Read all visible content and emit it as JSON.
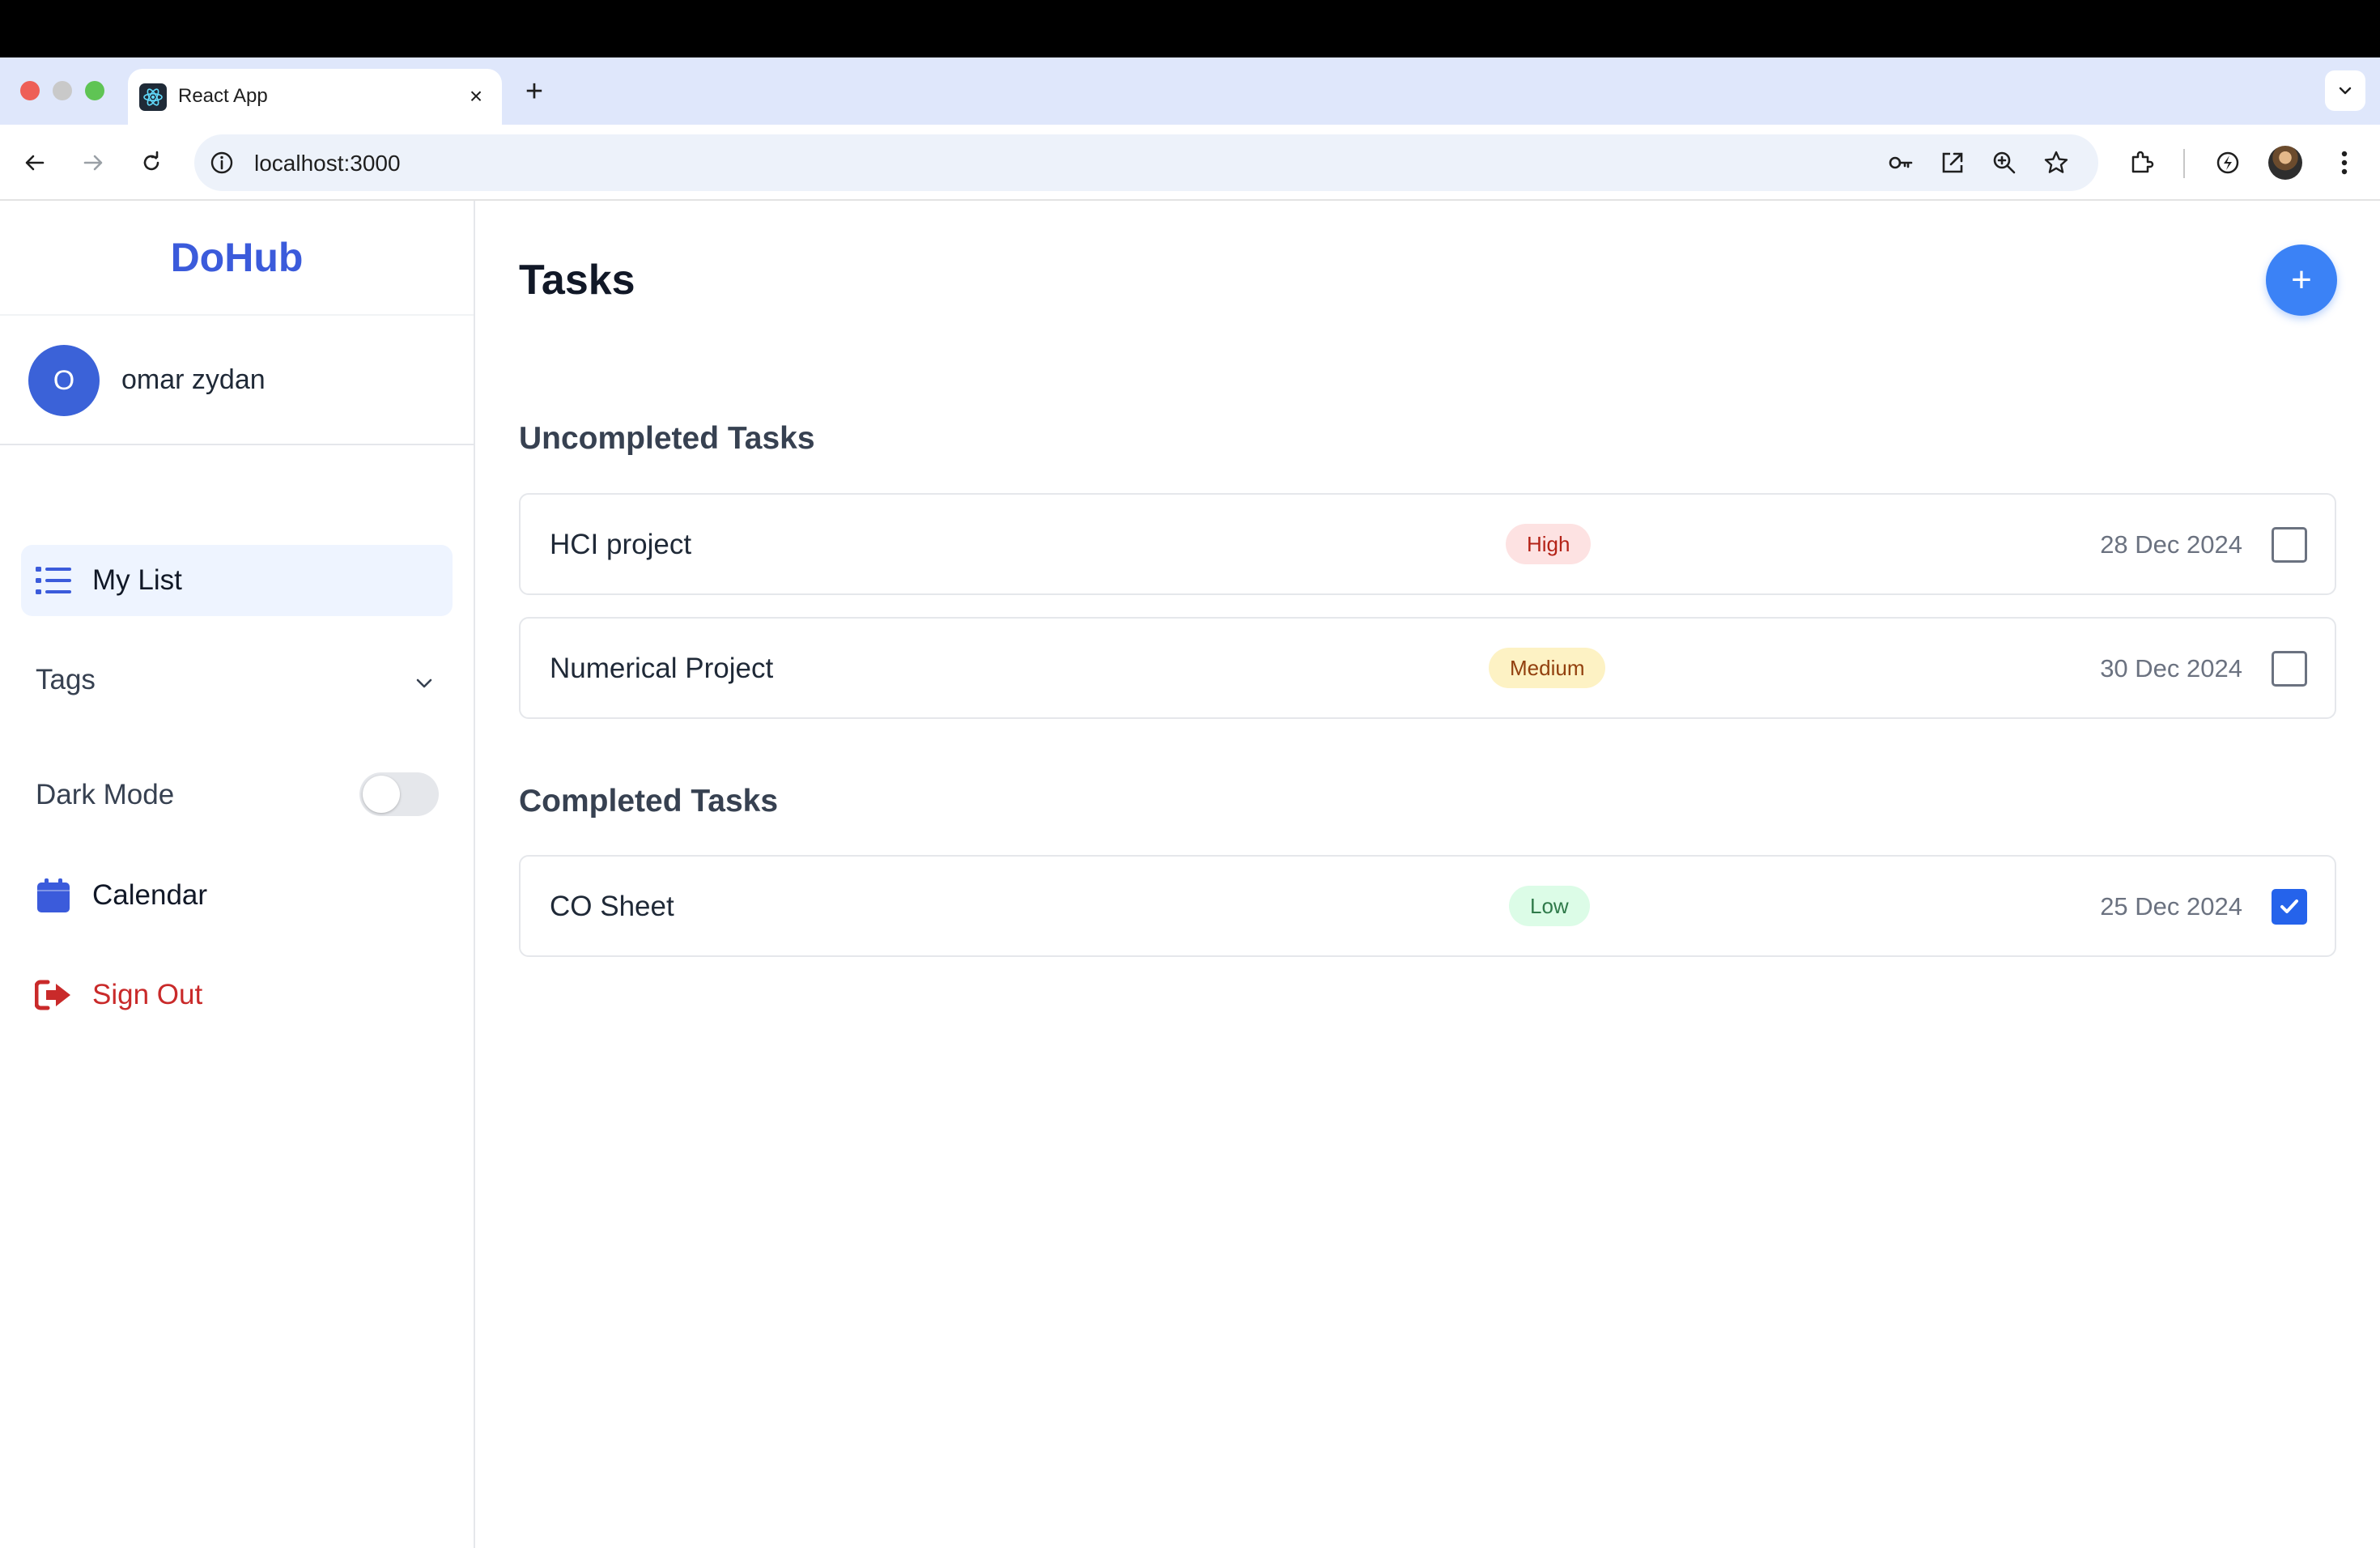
{
  "browser": {
    "tab_title": "React App",
    "tab_close": "×",
    "new_tab": "+",
    "url": "localhost:3000",
    "icons": [
      "react-favicon",
      "back-icon",
      "forward-icon",
      "reload-icon",
      "info-icon",
      "key-icon",
      "open-external-icon",
      "zoom-icon",
      "star-icon",
      "extensions-icon",
      "performance-icon",
      "profile-avatar",
      "more-icon",
      "tab-search-icon"
    ]
  },
  "sidebar": {
    "brand": "DoHub",
    "user": {
      "initial": "O",
      "name": "omar zydan"
    },
    "items": {
      "my_list": "My List",
      "tags": "Tags",
      "dark_mode": "Dark Mode",
      "calendar": "Calendar",
      "sign_out": "Sign Out"
    },
    "dark_mode_on": false
  },
  "main": {
    "title": "Tasks",
    "add_button": "+",
    "uncompleted_title": "Uncompleted Tasks",
    "completed_title": "Completed Tasks",
    "uncompleted": [
      {
        "name": "HCI project",
        "priority": "High",
        "date": "28 Dec 2024",
        "done": false
      },
      {
        "name": "Numerical Project",
        "priority": "Medium",
        "date": "30 Dec 2024",
        "done": false
      }
    ],
    "completed": [
      {
        "name": "CO Sheet",
        "priority": "Low",
        "date": "25 Dec 2024",
        "done": true
      }
    ]
  },
  "colors": {
    "brand": "#3b5bdb",
    "accent": "#3b82f6",
    "sign_out": "#c92a2a",
    "high": "#fde2e2",
    "medium": "#fdf2c4",
    "low": "#dcfce7"
  }
}
